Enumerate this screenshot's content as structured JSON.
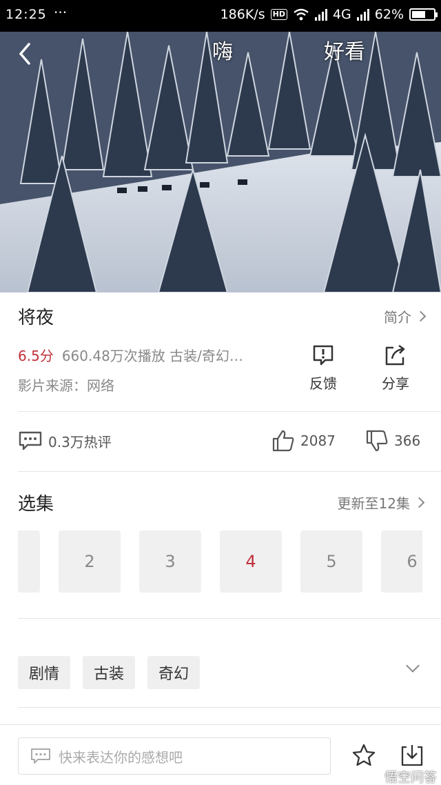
{
  "status_bar": {
    "time": "12:25",
    "dots": "···",
    "speed": "186K/s",
    "hd": "HD",
    "network": "4G",
    "battery": "62%",
    "battery_level": 0.62
  },
  "player": {
    "danmu": [
      "嗨",
      "好看"
    ]
  },
  "info": {
    "title": "将夜",
    "intro_label": "简介",
    "score": "6.5分",
    "plays_genre": "660.48万次播放 古装/奇幻…",
    "source": "影片来源：网络",
    "feedback_label": "反馈",
    "share_label": "分享"
  },
  "stats": {
    "comments": "0.3万热评",
    "likes": "2087",
    "dislikes": "366"
  },
  "episodes": {
    "title": "选集",
    "update": "更新至12集",
    "items": [
      {
        "label": "",
        "active": false
      },
      {
        "label": "2",
        "active": false
      },
      {
        "label": "3",
        "active": false
      },
      {
        "label": "4",
        "active": true
      },
      {
        "label": "5",
        "active": false
      },
      {
        "label": "6",
        "active": false
      }
    ]
  },
  "tags": [
    "剧情",
    "古装",
    "奇幻"
  ],
  "bottom_bar": {
    "placeholder": "快来表达你的感想吧"
  },
  "watermark": "悟空问答",
  "colors": {
    "accent": "#c0303a"
  }
}
